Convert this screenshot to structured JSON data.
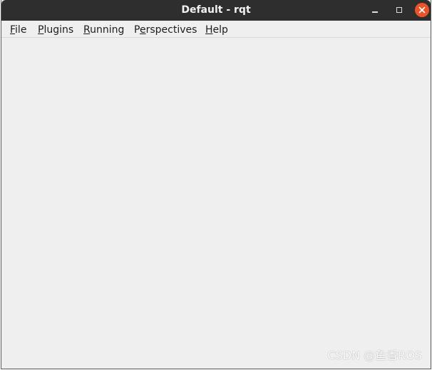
{
  "window": {
    "title": "Default - rqt"
  },
  "menubar": {
    "items": [
      {
        "mnemonic": "F",
        "rest": "ile"
      },
      {
        "mnemonic": "P",
        "rest": "lugins"
      },
      {
        "mnemonic": "R",
        "rest": "unning"
      },
      {
        "pre": "P",
        "mnemonic": "e",
        "rest": "rspectives"
      },
      {
        "mnemonic": "H",
        "rest": "elp"
      }
    ]
  },
  "watermark": {
    "text": "CSDN @鱼香ROS"
  },
  "colors": {
    "titlebar": "#2e2e2e",
    "close_button": "#e9542b",
    "background": "#efefef"
  },
  "icons": {
    "minimize": "minimize-icon",
    "maximize": "maximize-icon",
    "close": "close-icon"
  }
}
